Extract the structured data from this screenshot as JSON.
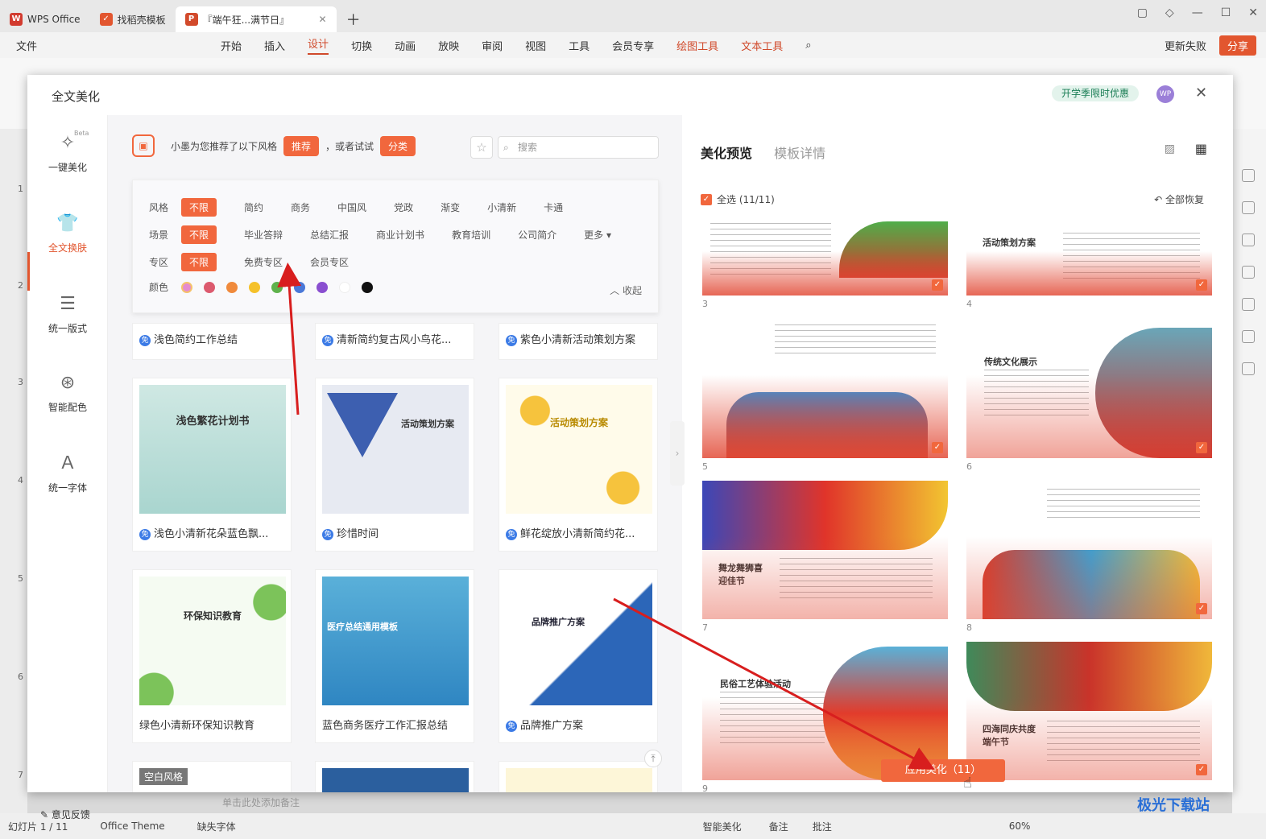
{
  "tabs": {
    "wps": "WPS Office",
    "template": "找稻壳模板",
    "doc": "『端午狂...满节日』"
  },
  "menu": {
    "file": "文件",
    "items": [
      "开始",
      "插入",
      "设计",
      "切换",
      "动画",
      "放映",
      "审阅",
      "视图",
      "工具",
      "会员专享",
      "绘图工具",
      "文本工具"
    ],
    "update": "更新失败",
    "share": "分享"
  },
  "slide_numbers": [
    "1",
    "2",
    "3",
    "4",
    "5",
    "6",
    "7"
  ],
  "status": {
    "slide": "幻灯片 1 / 11",
    "theme": "Office Theme",
    "font": "缺失字体",
    "notes_hint": "单击此处添加备注",
    "beautify": "智能美化",
    "notes": "备注",
    "comment": "批注",
    "zoom": "60%"
  },
  "dialog": {
    "title": "全文美化",
    "promo": "开学季限时优惠",
    "avatar": "WP",
    "nav": [
      {
        "label": "一键美化",
        "beta": "Beta"
      },
      {
        "label": "全文换肤"
      },
      {
        "label": "统一版式"
      },
      {
        "label": "智能配色"
      },
      {
        "label": "统一字体"
      }
    ],
    "feedback": "意见反馈",
    "rec": {
      "text": "小墨为您推荐了以下风格",
      "pill1": "推荐",
      "or": "，或者试试",
      "pill2": "分类"
    },
    "search_placeholder": "搜索",
    "filter": {
      "style": {
        "label": "风格",
        "options": [
          "不限",
          "简约",
          "商务",
          "中国风",
          "党政",
          "渐变",
          "小清新",
          "卡通"
        ]
      },
      "scene": {
        "label": "场景",
        "options": [
          "不限",
          "毕业答辩",
          "总结汇报",
          "商业计划书",
          "教育培训",
          "公司简介",
          "更多"
        ]
      },
      "zone": {
        "label": "专区",
        "options": [
          "不限",
          "免费专区",
          "会员专区"
        ]
      },
      "color": {
        "label": "颜色",
        "swatches": [
          "#e58bd0",
          "#dc5a6e",
          "#f08a3c",
          "#f5c12a",
          "#5fb24c",
          "#4a78d8",
          "#8a4fd0",
          "#ffffff",
          "#111111"
        ]
      },
      "collapse": "收起"
    },
    "templates": [
      {
        "name": "浅色简约工作总结",
        "free": "免"
      },
      {
        "name": "清新简约复古风小鸟花...",
        "free": "免"
      },
      {
        "name": "紫色小清新活动策划方案",
        "free": "免"
      },
      {
        "name": "浅色小清新花朵蓝色飘...",
        "free": "免",
        "thumb_title": "浅色繁花计划书"
      },
      {
        "name": "珍惜时间",
        "free": "免",
        "thumb_title": "活动策划方案"
      },
      {
        "name": "鲜花绽放小清新简约花...",
        "free": "免",
        "thumb_title": "活动策划方案"
      },
      {
        "name": "绿色小清新环保知识教育",
        "thumb_title": "环保知识教育"
      },
      {
        "name": "蓝色商务医疗工作汇报总结",
        "thumb_title": "医疗总结通用模板"
      },
      {
        "name": "品牌推广方案",
        "free": "免",
        "thumb_title": "品牌推广方案"
      },
      {
        "name": "空白风格"
      }
    ],
    "preview": {
      "tab1": "美化预览",
      "tab2": "模板详情",
      "select_all": "全选 (11/11)",
      "restore": "全部恢复",
      "slides": [
        {
          "num": "3"
        },
        {
          "num": "4",
          "title": "活动策划方案"
        },
        {
          "num": "5"
        },
        {
          "num": "6",
          "title": "传统文化展示"
        },
        {
          "num": "7",
          "title": "舞龙舞狮喜迎佳节"
        },
        {
          "num": "8"
        },
        {
          "num": "9",
          "title": "民俗工艺体验活动"
        },
        {
          "num": "",
          "title": "四海同庆共度端午节"
        }
      ]
    },
    "apply": "应用美化（11）"
  },
  "watermark": "极光下载站"
}
